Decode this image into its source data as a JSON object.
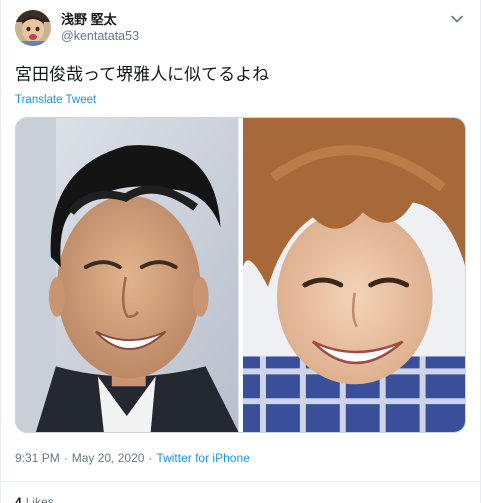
{
  "author": {
    "display_name": "浅野 堅太",
    "handle": "@kentatata53",
    "avatar_icon": "user-avatar"
  },
  "menu_icon": "chevron-down-icon",
  "tweet": {
    "text": "宮田俊哉って堺雅人に似てるよね",
    "translate_label": "Translate Tweet"
  },
  "media": {
    "photos": [
      {
        "icon": "photo-left"
      },
      {
        "icon": "photo-right"
      }
    ]
  },
  "meta": {
    "time": "9:31 PM",
    "separator": "·",
    "date": "May 20, 2020",
    "separator2": "·",
    "source": "Twitter for iPhone"
  },
  "stats": {
    "likes_count": "4",
    "likes_label": "Likes"
  },
  "colors": {
    "link": "#1b95e0",
    "secondary_text": "#657786",
    "border": "#e6ecf0"
  }
}
